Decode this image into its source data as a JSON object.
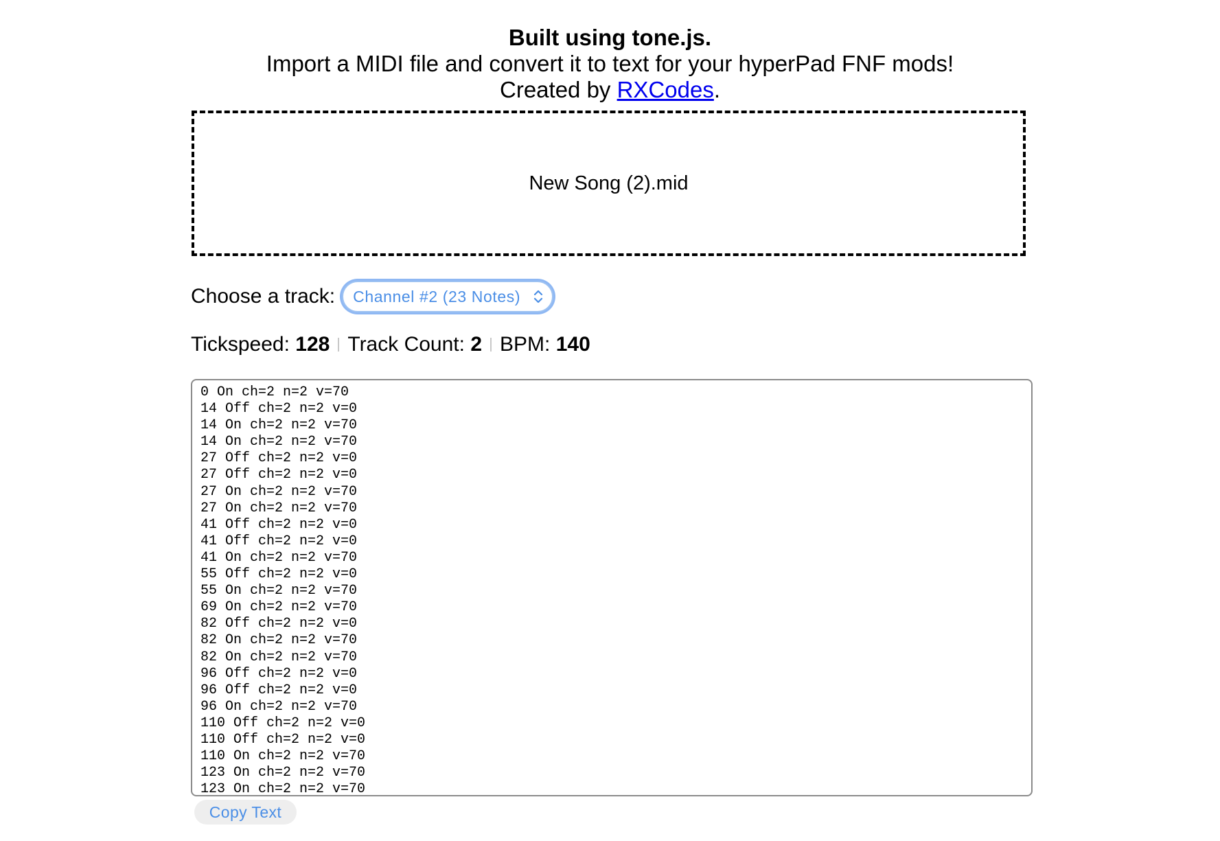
{
  "header": {
    "title": "Built using tone.js.",
    "subtitle": "Import a MIDI file and convert it to text for your hyperPad FNF mods!",
    "credit_prefix": "Created by ",
    "credit_link": "RXCodes",
    "credit_suffix": "."
  },
  "dropzone": {
    "filename": "New Song (2).mid"
  },
  "track": {
    "label": "Choose a track:",
    "selected": "Channel #2 (23 Notes)",
    "chevron_icon": "up-down-chevron-icon",
    "accent_color": "#4a8ee6"
  },
  "stats": {
    "tickspeed_label": "Tickspeed:",
    "tickspeed_value": "128",
    "track_count_label": "Track Count:",
    "track_count_value": "2",
    "bpm_label": "BPM:",
    "bpm_value": "140"
  },
  "output": {
    "lines": [
      "0 On ch=2 n=2 v=70",
      "14 Off ch=2 n=2 v=0",
      "14 On ch=2 n=2 v=70",
      "14 On ch=2 n=2 v=70",
      "27 Off ch=2 n=2 v=0",
      "27 Off ch=2 n=2 v=0",
      "27 On ch=2 n=2 v=70",
      "27 On ch=2 n=2 v=70",
      "41 Off ch=2 n=2 v=0",
      "41 Off ch=2 n=2 v=0",
      "41 On ch=2 n=2 v=70",
      "55 Off ch=2 n=2 v=0",
      "55 On ch=2 n=2 v=70",
      "69 On ch=2 n=2 v=70",
      "82 Off ch=2 n=2 v=0",
      "82 On ch=2 n=2 v=70",
      "82 On ch=2 n=2 v=70",
      "96 Off ch=2 n=2 v=0",
      "96 Off ch=2 n=2 v=0",
      "96 On ch=2 n=2 v=70",
      "110 Off ch=2 n=2 v=0",
      "110 Off ch=2 n=2 v=0",
      "110 On ch=2 n=2 v=70",
      "123 On ch=2 n=2 v=70",
      "123 On ch=2 n=2 v=70"
    ]
  },
  "copy_button": {
    "label": "Copy Text"
  }
}
